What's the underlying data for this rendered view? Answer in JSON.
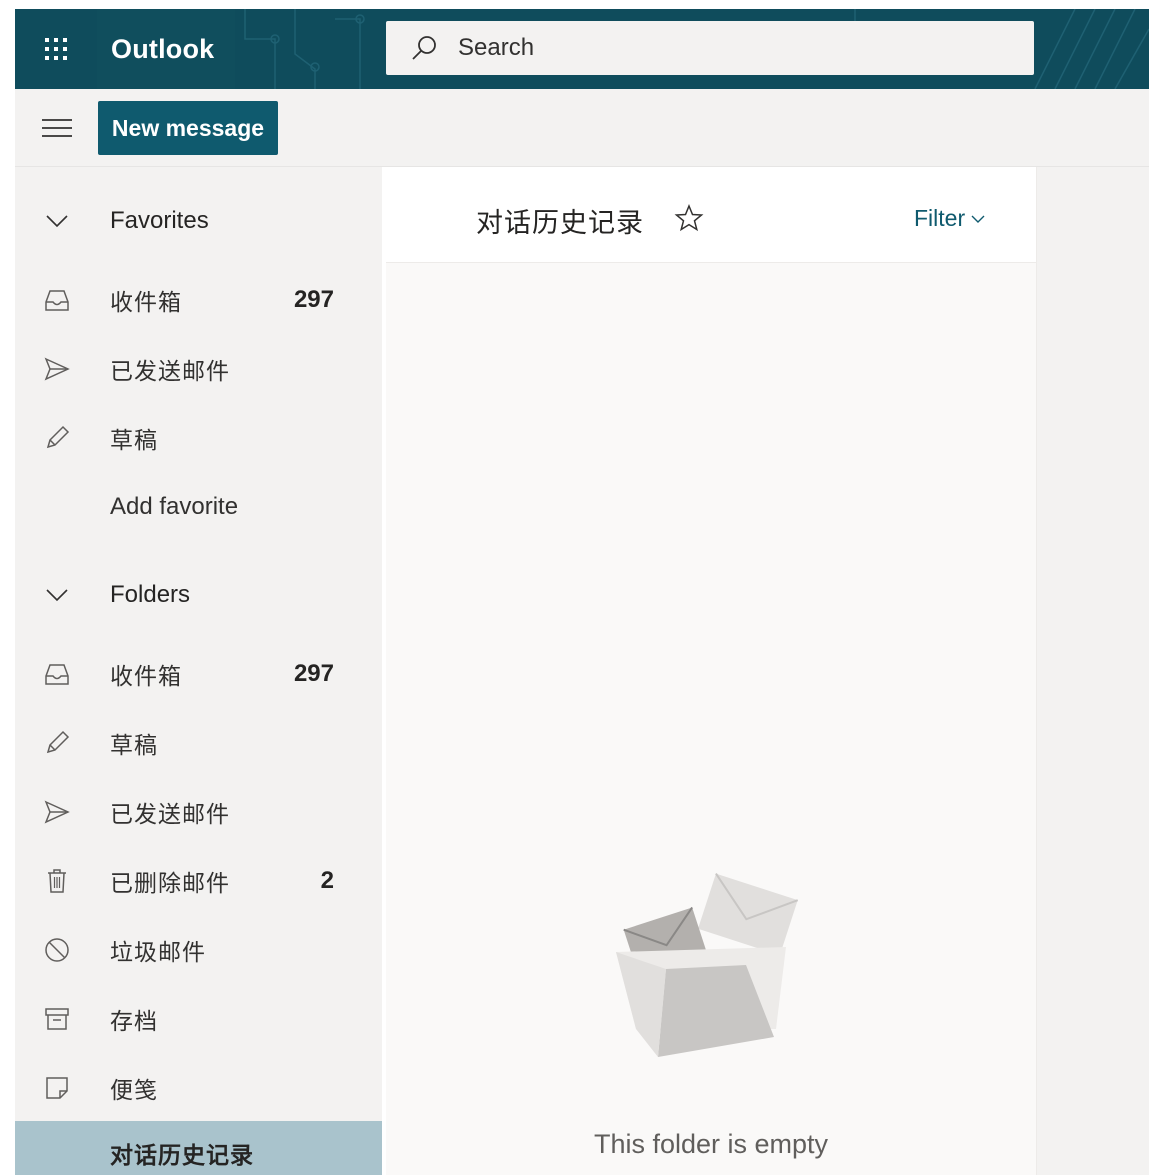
{
  "header": {
    "app_name": "Outlook",
    "search_placeholder": "Search",
    "theme_color": "#0f4c5c"
  },
  "commandbar": {
    "new_message_label": "New message",
    "accent": "#0f5a6e"
  },
  "favorites": {
    "label": "Favorites",
    "items": [
      {
        "icon": "inbox-icon",
        "label": "收件箱",
        "count": "297"
      },
      {
        "icon": "sent-icon",
        "label": "已发送邮件",
        "count": ""
      },
      {
        "icon": "drafts-pencil-icon",
        "label": "草稿",
        "count": ""
      }
    ],
    "add_favorite_label": "Add favorite"
  },
  "folders": {
    "label": "Folders",
    "items": [
      {
        "icon": "inbox-icon",
        "label": "收件箱",
        "count": "297"
      },
      {
        "icon": "drafts-pencil-icon",
        "label": "草稿",
        "count": ""
      },
      {
        "icon": "sent-icon",
        "label": "已发送邮件",
        "count": ""
      },
      {
        "icon": "trash-icon",
        "label": "已删除邮件",
        "count": "2"
      },
      {
        "icon": "junk-blocked-icon",
        "label": "垃圾邮件",
        "count": ""
      },
      {
        "icon": "archive-icon",
        "label": "存档",
        "count": ""
      },
      {
        "icon": "notes-icon",
        "label": "便笺",
        "count": ""
      },
      {
        "icon": "",
        "label": "对话历史记录",
        "count": "",
        "selected": true
      }
    ]
  },
  "message_list": {
    "folder_title": "对话历史记录",
    "filter_label": "Filter",
    "empty_text": "This folder is empty"
  }
}
